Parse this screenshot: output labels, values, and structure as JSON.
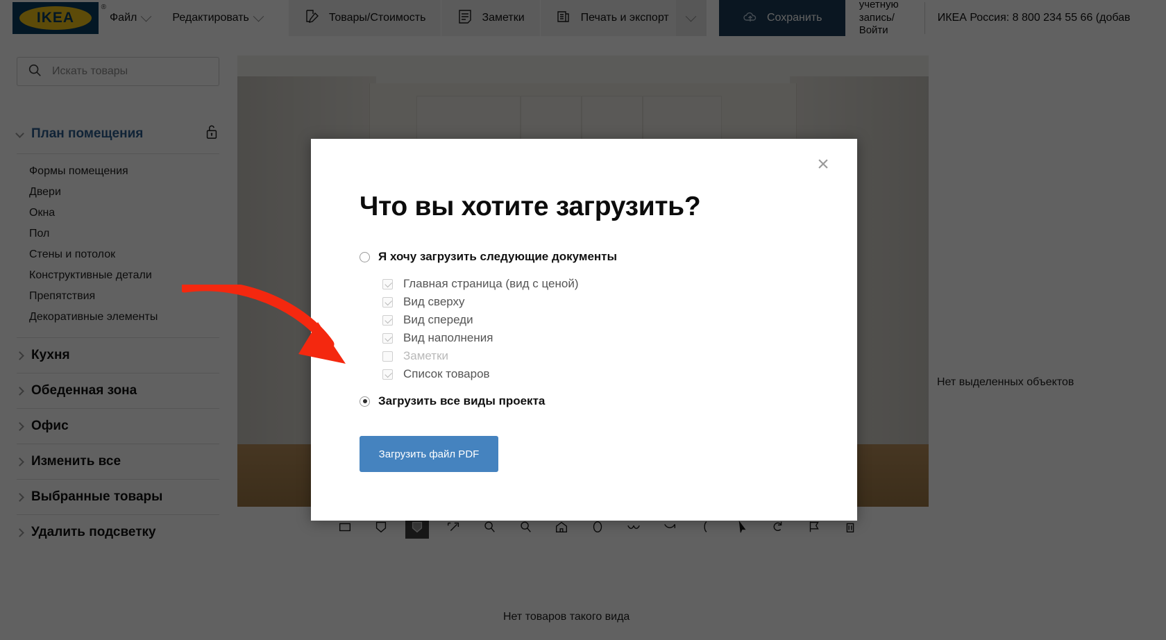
{
  "topbar": {
    "logo_text": "IKEA",
    "logo_reg": "®",
    "menus": [
      {
        "label": "Файл",
        "icon": "chevron-down-icon"
      },
      {
        "label": "Редактировать",
        "icon": "chevron-down-icon"
      }
    ],
    "tools": [
      {
        "label": "Товары/Стоимость",
        "icon": "edit-price-icon",
        "has_caret": false
      },
      {
        "label": "Заметки",
        "icon": "notes-icon",
        "has_caret": false
      },
      {
        "label": "Печать и экспорт",
        "icon": "print-export-icon",
        "has_caret": true
      }
    ],
    "save_label": "Сохранить",
    "save_icon": "cloud-upload-icon",
    "account_label": "учетную запись/ Войти",
    "phone_text": "ИКЕА Россия: 8 800 234 55 66 (добав"
  },
  "sidebar": {
    "search_placeholder": "Искать товары",
    "search_value": "",
    "search_icon": "search-icon",
    "lock_icon": "unlock-icon",
    "sections": [
      {
        "title": "План помещения",
        "open": true,
        "items": [
          "Формы помещения",
          "Двери",
          "Окна",
          "Пол",
          "Стены и потолок",
          "Конструктивные детали",
          "Препятствия",
          "Декоративные элементы"
        ]
      },
      {
        "title": "Кухня",
        "open": false,
        "items": []
      },
      {
        "title": "Обеденная зона",
        "open": false,
        "items": []
      },
      {
        "title": "Офис",
        "open": false,
        "items": []
      },
      {
        "title": "Изменить все",
        "open": false,
        "items": []
      },
      {
        "title": "Выбранные товары",
        "open": false,
        "items": []
      },
      {
        "title": "Удалить подсветку",
        "open": false,
        "items": []
      }
    ]
  },
  "canvas": {
    "no_selection_text": "Нет выделенных объектов",
    "no_products_text": "Нет товаров такого вида",
    "toolbar_icons": [
      "rectangle-tool-icon",
      "outline-shape-icon",
      "filled-shape-icon",
      "move-tool-icon",
      "zoom-in-icon",
      "zoom-out-icon",
      "home-view-icon",
      "ellipse-tool-icon",
      "curve-tool-icon",
      "arc-tool-icon",
      "bracket-tool-icon",
      "cursor-arrow-icon",
      "undo-rotate-icon",
      "flag-icon",
      "trash-icon"
    ],
    "active_icon_index": 2
  },
  "modal": {
    "close_icon": "close-icon",
    "title": "Что вы хотите загрузить?",
    "options": [
      {
        "label": "Я хочу загрузить следующие документы",
        "selected": false
      },
      {
        "label": "Загрузить все виды проекта",
        "selected": true
      }
    ],
    "documents": [
      {
        "label": "Главная страница (вид с ценой)",
        "checked": true,
        "enabled": true
      },
      {
        "label": "Вид сверху",
        "checked": true,
        "enabled": true
      },
      {
        "label": "Вид спереди",
        "checked": true,
        "enabled": true
      },
      {
        "label": "Вид наполнения",
        "checked": true,
        "enabled": true
      },
      {
        "label": "Заметки",
        "checked": false,
        "enabled": false
      },
      {
        "label": "Список товаров",
        "checked": true,
        "enabled": true
      }
    ],
    "download_button_label": "Загрузить файл PDF"
  },
  "annotation": {
    "arrow_color": "#f4280f",
    "arrow_icon": "red-curved-arrow-annotation"
  },
  "colors": {
    "brand_blue": "#0a3d62",
    "brand_yellow": "#f5c518",
    "save_button": "#1b3a57",
    "primary_button": "#4583bf",
    "section_open": "#2c5d8f",
    "overlay": "rgba(0,0,0,0.62)"
  }
}
